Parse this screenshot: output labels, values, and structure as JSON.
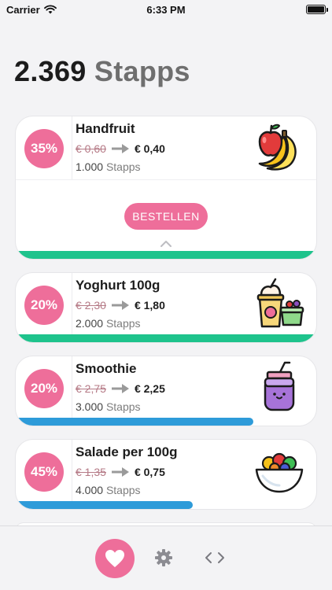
{
  "status_bar": {
    "carrier": "Carrier",
    "time": "6:33 PM"
  },
  "header": {
    "points": "2.369",
    "unit": "Stapps"
  },
  "colors": {
    "pink": "#ee6e9a",
    "green": "#1ec38c",
    "blue": "#2e9bd9"
  },
  "products": [
    {
      "discount": "35%",
      "name": "Handfruit",
      "old_price": "€ 0,60",
      "new_price": "€ 0,40",
      "stapps_amount": "1.000",
      "stapps_unit": "Stapps",
      "illustration": "fruit-icon",
      "expanded": true,
      "order_label": "BESTELLEN",
      "progress": 1.0,
      "progress_color": "green"
    },
    {
      "discount": "20%",
      "name": "Yoghurt 100g",
      "old_price": "€ 2,30",
      "new_price": "€ 1,80",
      "stapps_amount": "2.000",
      "stapps_unit": "Stapps",
      "illustration": "yoghurt-icon",
      "expanded": false,
      "progress": 1.0,
      "progress_color": "green"
    },
    {
      "discount": "20%",
      "name": "Smoothie",
      "old_price": "€ 2,75",
      "new_price": "€ 2,25",
      "stapps_amount": "3.000",
      "stapps_unit": "Stapps",
      "illustration": "smoothie-icon",
      "expanded": false,
      "progress": 0.79,
      "progress_color": "blue"
    },
    {
      "discount": "45%",
      "name": "Salade per 100g",
      "old_price": "€ 1,35",
      "new_price": "€ 0,75",
      "stapps_amount": "4.000",
      "stapps_unit": "Stapps",
      "illustration": "salad-icon",
      "expanded": false,
      "progress": 0.59,
      "progress_color": "blue"
    }
  ],
  "tab_bar": {
    "items": [
      {
        "icon": "heart-icon",
        "active": true
      },
      {
        "icon": "gear-icon",
        "active": false
      },
      {
        "icon": "code-icon",
        "active": false
      }
    ]
  }
}
